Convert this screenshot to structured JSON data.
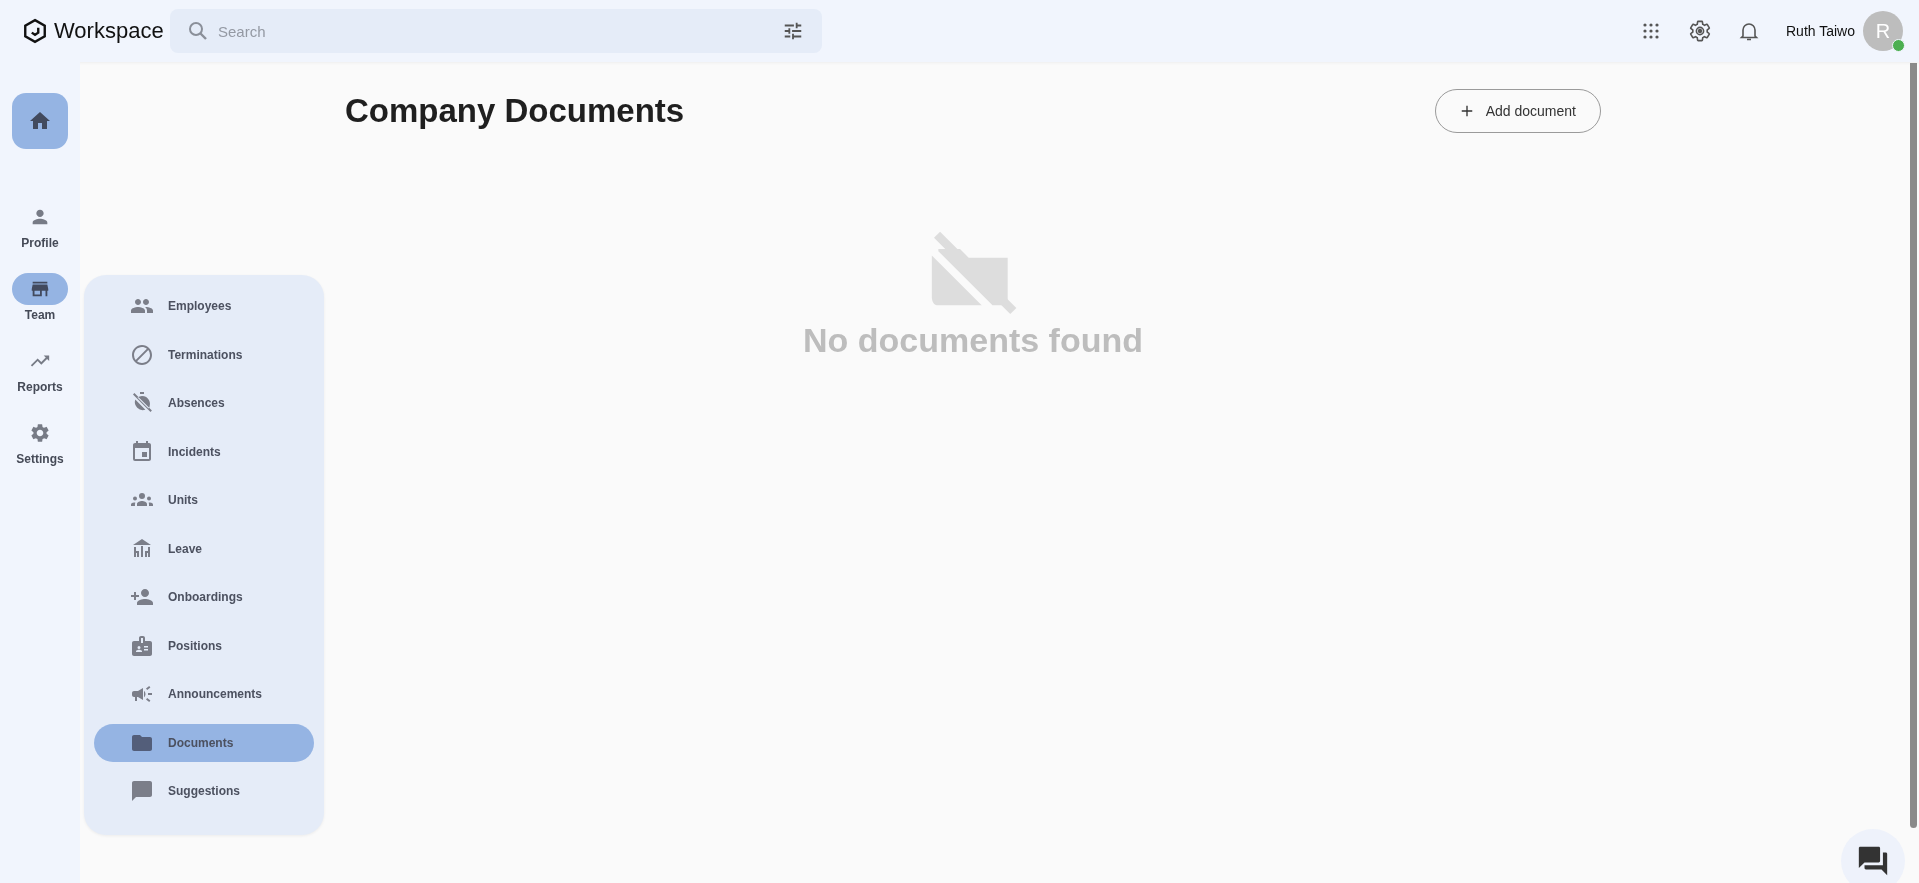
{
  "app": {
    "name": "Workspace"
  },
  "search": {
    "placeholder": "Search"
  },
  "user": {
    "name": "Ruth Taiwo",
    "initial": "R",
    "online": true
  },
  "rail": {
    "home": {
      "selected": true
    },
    "items": [
      {
        "label": "Profile",
        "selected": false
      },
      {
        "label": "Team",
        "selected": true
      },
      {
        "label": "Reports",
        "selected": false
      },
      {
        "label": "Settings",
        "selected": false
      }
    ]
  },
  "submenu": [
    {
      "label": "Employees",
      "selected": false
    },
    {
      "label": "Terminations",
      "selected": false
    },
    {
      "label": "Absences",
      "selected": false
    },
    {
      "label": "Incidents",
      "selected": false
    },
    {
      "label": "Units",
      "selected": false
    },
    {
      "label": "Leave",
      "selected": false
    },
    {
      "label": "Onboardings",
      "selected": false
    },
    {
      "label": "Positions",
      "selected": false
    },
    {
      "label": "Announcements",
      "selected": false
    },
    {
      "label": "Documents",
      "selected": true
    },
    {
      "label": "Suggestions",
      "selected": false
    }
  ],
  "page": {
    "title": "Company Documents",
    "add_button": "Add document"
  },
  "empty_state": {
    "message": "No documents found"
  }
}
